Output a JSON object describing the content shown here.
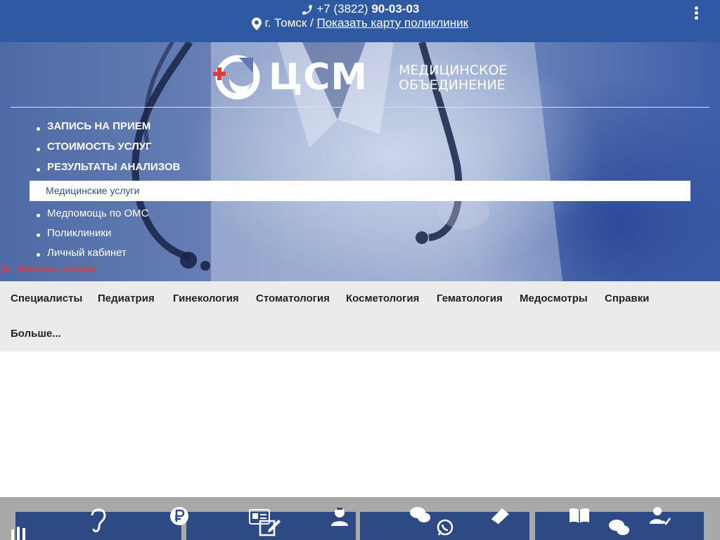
{
  "header": {
    "phone_prefix": "+7 (3822)",
    "phone_number": "90-03-03",
    "city": "г. Томск /",
    "map_link": "Показать карту поликлиник"
  },
  "logo": {
    "brand": "ЦСМ",
    "line1": "МЕДИЦИНСКОЕ",
    "line2": "ОБЪЕДИНЕНИЕ"
  },
  "menu": {
    "primary": [
      "ЗАПИСЬ НА ПРИЕМ",
      "СТОИМОСТЬ УСЛУГ",
      "РЕЗУЛЬТАТЫ АНАЛИЗОВ"
    ],
    "active": "Медицинские услуги",
    "secondary": [
      "Медпомощь по ОМС",
      "Поликлиники",
      "Личный кабинет"
    ]
  },
  "callback_label": "Заказать звонок",
  "categories": [
    "Специалисты",
    "Педиатрия",
    "Гинекология",
    "Стоматология",
    "Косметология",
    "Гематология",
    "Медосмотры",
    "Справки",
    "Больше..."
  ],
  "colors": {
    "topbar": "#2f5aa3",
    "callback": "#e23b3b",
    "active_text": "#2f4f8c",
    "category_bg": "#ebebeb",
    "tile": "#2d4a84"
  },
  "bottom_icons": [
    "ear-icon",
    "ruble-icon",
    "id-card-icon",
    "pencil-edit-icon",
    "nurse-icon",
    "chat-icon",
    "whatsapp-icon",
    "book-icon",
    "open-book-icon",
    "chat-bubbles-icon",
    "user-check-icon",
    "test-tubes-icon"
  ]
}
